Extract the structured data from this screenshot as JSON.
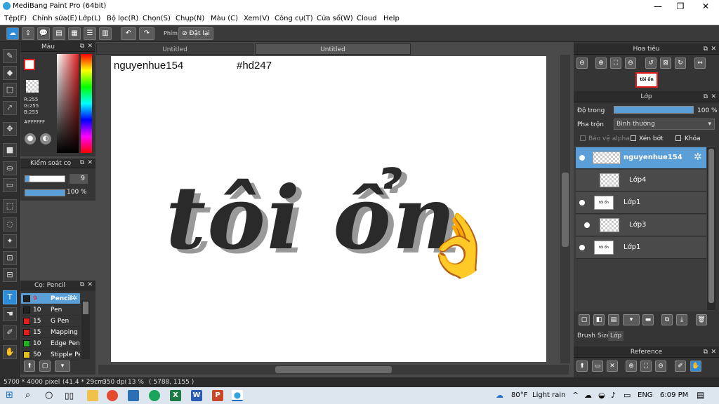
{
  "window": {
    "title": "MediBang Paint Pro (64bit)"
  },
  "menu": [
    "Tệp(F)",
    "Chỉnh sửa(E)",
    "Lớp(L)",
    "Bộ lọc(R)",
    "Chọn(S)",
    "Chụp(N)",
    "Màu (C)",
    "Xem(V)",
    "Công cụ(T)",
    "Cửa sổ(W)",
    "Cloud",
    "Help"
  ],
  "toolbar": {
    "shortcut_label": "Phím",
    "reset_label": "Đặt lại"
  },
  "color_panel": {
    "title": "Màu",
    "r": "R:255",
    "g": "G:255",
    "b": "B:255",
    "hex": "#FFFFFF"
  },
  "brush_control": {
    "title": "Kiểm soát cọ",
    "size": "9",
    "opacity": "100 %"
  },
  "brush_panel": {
    "title": "Cọ: Pencil",
    "items": [
      {
        "size": "9",
        "name": "Pencil",
        "color": "#222222"
      },
      {
        "size": "10",
        "name": "Pen",
        "color": "#222222"
      },
      {
        "size": "15",
        "name": "G Pen",
        "color": "#e02020"
      },
      {
        "size": "15",
        "name": "Mapping Pen",
        "color": "#e02020"
      },
      {
        "size": "10",
        "name": "Edge Pen",
        "color": "#20b020"
      },
      {
        "size": "50",
        "name": "Stipple Pen",
        "color": "#e0c020"
      }
    ]
  },
  "tabs": [
    "Untitled",
    "Untitled"
  ],
  "canvas": {
    "username": "nguyenhue154",
    "hashtag": "#hd247",
    "artwork_text": "tôi ổn",
    "emoji": "👌"
  },
  "navigator": {
    "title": "Hoa tiêu",
    "thumb_text": "tôi ổn"
  },
  "layers_panel": {
    "title": "Lớp",
    "opacity_label": "Độ trong",
    "opacity_value": "100 %",
    "blend_label": "Pha trộn",
    "blend_value": "Bình thường",
    "protect_alpha": "Bảo vệ alpha",
    "clipping": "Xén bớt",
    "lock": "Khóa",
    "layers": [
      {
        "name": "nguyenhue154",
        "thumb": "checker",
        "selected": true
      },
      {
        "name": "Lớp4",
        "thumb": "checker",
        "selected": false
      },
      {
        "name": "Lớp1",
        "thumb": "tôi ổn",
        "selected": false
      },
      {
        "name": "Lớp3",
        "thumb": "checker",
        "selected": false
      },
      {
        "name": "Lớp1",
        "thumb": "tôi ổn",
        "selected": false
      }
    ],
    "bottom_tabs": [
      "Brush Size",
      "Lớp"
    ]
  },
  "reference_panel": {
    "title": "Reference"
  },
  "status": {
    "dimensions": "5700 * 4000 pixel",
    "size_cm": "(41.4 * 29cm)",
    "dpi": "350 dpi",
    "zoom": "13 %",
    "coords": "( 5788, 1155 )"
  },
  "taskbar": {
    "weather_temp": "80°F",
    "weather_text": "Light rain",
    "lang": "ENG",
    "time": "6:09 PM"
  },
  "colors": {
    "accent": "#5b9fd8",
    "panel_bg": "#353535",
    "canvas_bg": "#ffffff"
  }
}
